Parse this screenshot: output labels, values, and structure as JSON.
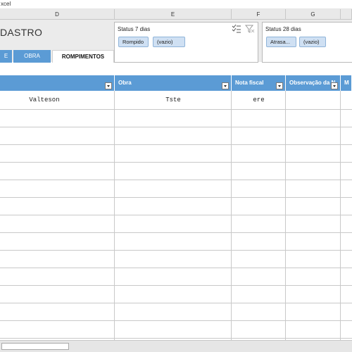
{
  "window": {
    "title": "xcel"
  },
  "column_headers": [
    "D",
    "E",
    "F",
    "G"
  ],
  "banner": {
    "title": "DASTRO"
  },
  "tabs": [
    {
      "label": "E"
    },
    {
      "label": "OBRA"
    },
    {
      "label": "ROMPIMENTOS"
    }
  ],
  "slicers": [
    {
      "title": "Status 7 dias",
      "items": [
        "Rompido",
        "(vazio)"
      ]
    },
    {
      "title": "Status 28 dias",
      "items": [
        "Atrasa...",
        "(vazio)"
      ]
    }
  ],
  "table": {
    "headers": [
      "",
      "Obra",
      "Nota fiscal",
      "Observação da N",
      "M"
    ],
    "rows": [
      [
        "Valteson",
        "Tste",
        "ere",
        "",
        ""
      ]
    ]
  },
  "colors": {
    "accent": "#5b9bd5",
    "slicer_item": "#cfe0f3"
  }
}
